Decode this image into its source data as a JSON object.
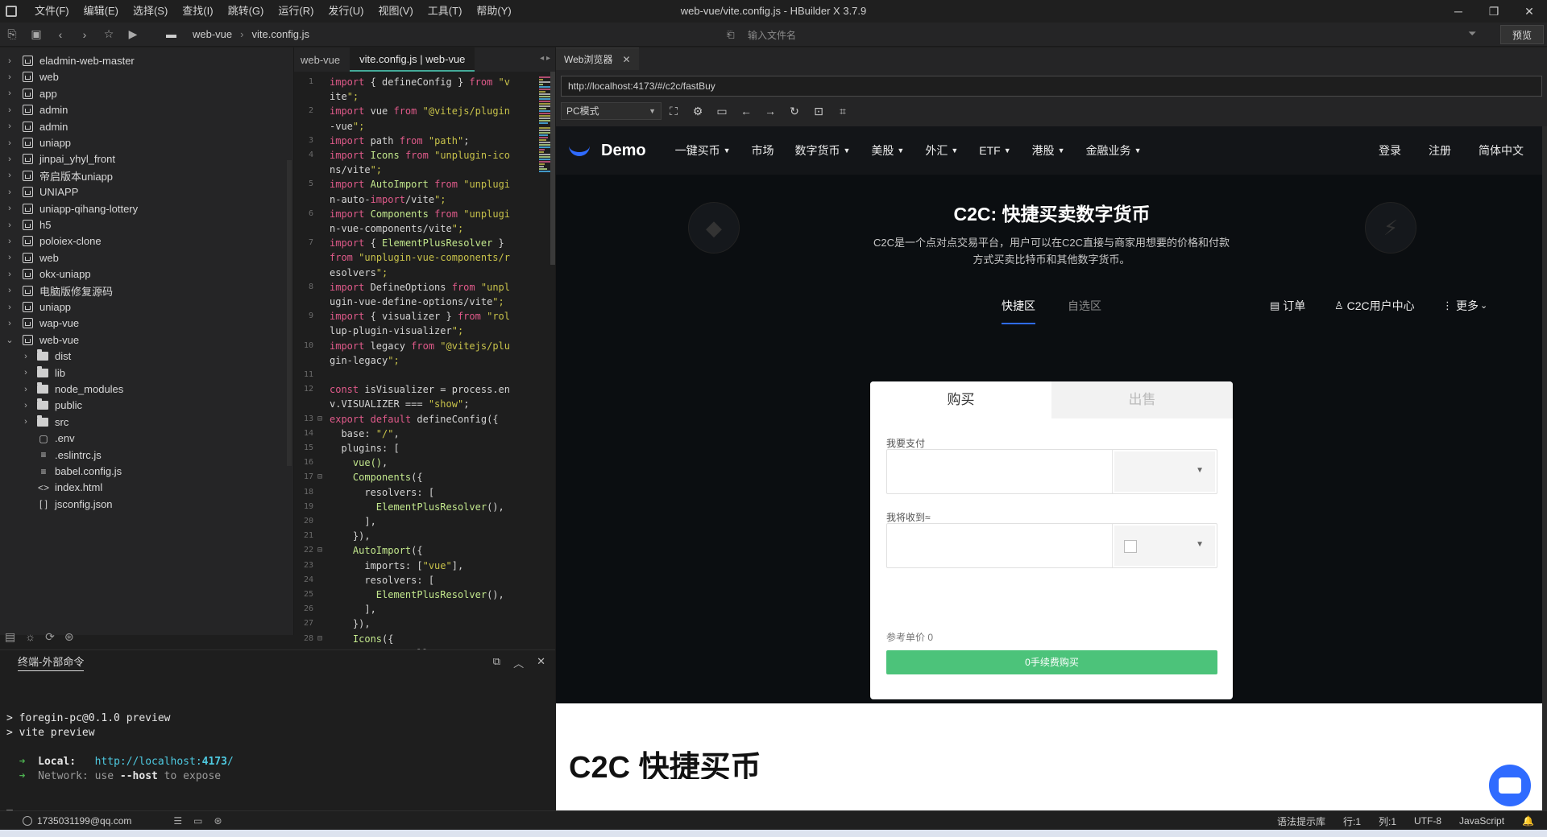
{
  "window": {
    "title": "web-vue/vite.config.js - HBuilder X 3.7.9",
    "menu": [
      "文件(F)",
      "编辑(E)",
      "选择(S)",
      "查找(I)",
      "跳转(G)",
      "运行(R)",
      "发行(U)",
      "视图(V)",
      "工具(T)",
      "帮助(Y)"
    ]
  },
  "toolbar": {
    "breadcrumb": [
      "web-vue",
      "vite.config.js"
    ],
    "file_search_placeholder": "输入文件名",
    "preview_label": "预览"
  },
  "tree": [
    {
      "label": "eladmin-web-master",
      "type": "project",
      "expanded": false
    },
    {
      "label": "web",
      "type": "project",
      "expanded": false
    },
    {
      "label": "app",
      "type": "project",
      "expanded": false
    },
    {
      "label": "admin",
      "type": "project",
      "expanded": false
    },
    {
      "label": "admin",
      "type": "project",
      "expanded": false
    },
    {
      "label": "uniapp",
      "type": "project",
      "expanded": false
    },
    {
      "label": "jinpai_yhyl_front",
      "type": "project",
      "expanded": false
    },
    {
      "label": "帝启版本uniapp",
      "type": "project",
      "expanded": false
    },
    {
      "label": "UNIAPP",
      "type": "project",
      "expanded": false
    },
    {
      "label": "uniapp-qihang-lottery",
      "type": "project",
      "expanded": false
    },
    {
      "label": "h5",
      "type": "project",
      "expanded": false
    },
    {
      "label": "poloiex-clone",
      "type": "project",
      "expanded": false
    },
    {
      "label": "web",
      "type": "project",
      "expanded": false
    },
    {
      "label": "okx-uniapp",
      "type": "project",
      "expanded": false
    },
    {
      "label": "电脑版修复源码",
      "type": "project",
      "expanded": false
    },
    {
      "label": "uniapp",
      "type": "project",
      "expanded": false
    },
    {
      "label": "wap-vue",
      "type": "project",
      "expanded": false
    },
    {
      "label": "web-vue",
      "type": "project",
      "expanded": true
    },
    {
      "label": "dist",
      "type": "folder",
      "expanded": false
    },
    {
      "label": "lib",
      "type": "folder",
      "expanded": false
    },
    {
      "label": "node_modules",
      "type": "folder",
      "expanded": false
    },
    {
      "label": "public",
      "type": "folder",
      "expanded": false
    },
    {
      "label": "src",
      "type": "folder",
      "expanded": false
    },
    {
      "label": ".env",
      "type": "file",
      "icon": "▢"
    },
    {
      "label": ".eslintrc.js",
      "type": "file",
      "icon": "≡"
    },
    {
      "label": "babel.config.js",
      "type": "file",
      "icon": "≡"
    },
    {
      "label": "index.html",
      "type": "file",
      "icon": "<>"
    },
    {
      "label": "jsconfig.json",
      "type": "file",
      "icon": "[ ]"
    }
  ],
  "editor": {
    "tabs": [
      "web-vue",
      "vite.config.js | web-vue"
    ],
    "lines": [
      {
        "n": "1",
        "t": "import { defineConfig } from \"v"
      },
      {
        "n": "",
        "t": "ite\";"
      },
      {
        "n": "2",
        "t": "import vue from \"@vitejs/plugin"
      },
      {
        "n": "",
        "t": "-vue\";"
      },
      {
        "n": "3",
        "t": "import path from \"path\";"
      },
      {
        "n": "4",
        "t": "import Icons from \"unplugin-ico"
      },
      {
        "n": "",
        "t": "ns/vite\";"
      },
      {
        "n": "5",
        "t": "import AutoImport from \"unplugi"
      },
      {
        "n": "",
        "t": "n-auto-import/vite\";"
      },
      {
        "n": "6",
        "t": "import Components from \"unplugi"
      },
      {
        "n": "",
        "t": "n-vue-components/vite\";"
      },
      {
        "n": "7",
        "t": "import { ElementPlusResolver }"
      },
      {
        "n": "",
        "t": "from \"unplugin-vue-components/r"
      },
      {
        "n": "",
        "t": "esolvers\";"
      },
      {
        "n": "8",
        "t": "import DefineOptions from \"unpl"
      },
      {
        "n": "",
        "t": "ugin-vue-define-options/vite\";"
      },
      {
        "n": "9",
        "t": "import { visualizer } from \"rol"
      },
      {
        "n": "",
        "t": "lup-plugin-visualizer\";"
      },
      {
        "n": "10",
        "t": "import legacy from \"@vitejs/plu"
      },
      {
        "n": "",
        "t": "gin-legacy\";"
      },
      {
        "n": "11",
        "t": ""
      },
      {
        "n": "12",
        "t": "const isVisualizer = process.en"
      },
      {
        "n": "",
        "t": "v.VISUALIZER === \"show\";"
      },
      {
        "n": "13",
        "t": "export default defineConfig({"
      },
      {
        "n": "14",
        "t": "  base: \"/\","
      },
      {
        "n": "15",
        "t": "  plugins: ["
      },
      {
        "n": "16",
        "t": "    vue(),"
      },
      {
        "n": "17",
        "t": "    Components({"
      },
      {
        "n": "18",
        "t": "      resolvers: ["
      },
      {
        "n": "19",
        "t": "        ElementPlusResolver(),"
      },
      {
        "n": "20",
        "t": "      ],"
      },
      {
        "n": "21",
        "t": "    }),"
      },
      {
        "n": "22",
        "t": "    AutoImport({"
      },
      {
        "n": "23",
        "t": "      imports: [\"vue\"],"
      },
      {
        "n": "24",
        "t": "      resolvers: ["
      },
      {
        "n": "25",
        "t": "        ElementPlusResolver(),"
      },
      {
        "n": "26",
        "t": "      ],"
      },
      {
        "n": "27",
        "t": "    }),"
      },
      {
        "n": "28",
        "t": "    Icons({"
      },
      {
        "n": "29",
        "t": "      autoInstall: true,"
      }
    ]
  },
  "terminal": {
    "tab": "终端-外部命令",
    "lines": [
      "> foregin-pc@0.1.0 preview",
      "> vite preview",
      "",
      "  ➜  Local:   http://localhost:4173/",
      "  ➜  Network: use --host to expose",
      "",
      "_"
    ]
  },
  "browser": {
    "tab": "Web浏览器",
    "url": "http://localhost:4173/#/c2c/fastBuy",
    "mode": "PC模式"
  },
  "webpage": {
    "brand": "Demo",
    "nav": [
      {
        "label": "一键买币",
        "dropdown": true
      },
      {
        "label": "市场",
        "dropdown": false
      },
      {
        "label": "数字货币",
        "dropdown": true
      },
      {
        "label": "美股",
        "dropdown": true
      },
      {
        "label": "外汇",
        "dropdown": true
      },
      {
        "label": "ETF",
        "dropdown": true
      },
      {
        "label": "港股",
        "dropdown": true
      },
      {
        "label": "金融业务",
        "dropdown": true
      }
    ],
    "nav_right": [
      "登录",
      "注册",
      "简体中文"
    ],
    "hero_title": "C2C: 快捷买卖数字货币",
    "hero_sub": "C2C是一个点对点交易平台，用户可以在C2C直接与商家用想要的价格和付款方式买卖比特币和其他数字货币。",
    "subtabs": [
      "快捷区",
      "自选区"
    ],
    "subtabs_right": [
      "订单",
      "C2C用户中心",
      "更多"
    ],
    "card": {
      "tab_buy": "购买",
      "tab_sell": "出售",
      "pay_label": "我要支付",
      "receive_label": "我将收到≈",
      "ref_price": "参考单价 0",
      "button": "0手续费购买"
    },
    "section_title": "C2C 快捷买币"
  },
  "status": {
    "user": "1735031199@qq.com",
    "right": [
      "语法提示库",
      "行:1",
      "列:1",
      "UTF-8",
      "JavaScript"
    ]
  },
  "colors": {
    "accent": "#2f6bff",
    "buy_button": "#4cc37a",
    "keyword": "#e05a8a",
    "string": "#c8c24a"
  }
}
